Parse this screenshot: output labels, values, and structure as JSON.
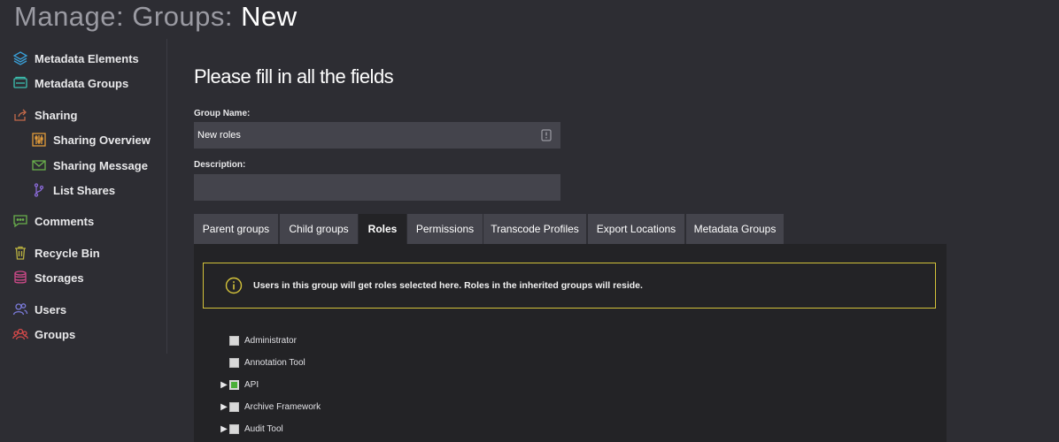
{
  "header": {
    "title_part1": "Manage: Groups: ",
    "title_part2": "New"
  },
  "sidebar": {
    "items": [
      {
        "label": "Metadata Elements",
        "icon": "layers-icon"
      },
      {
        "label": "Metadata Groups",
        "icon": "folders-icon"
      },
      {
        "label": "Sharing",
        "icon": "share-icon"
      },
      {
        "label": "Sharing Overview",
        "icon": "sliders-icon"
      },
      {
        "label": "Sharing Message",
        "icon": "envelope-icon"
      },
      {
        "label": "List Shares",
        "icon": "branch-icon"
      },
      {
        "label": "Comments",
        "icon": "comment-icon"
      },
      {
        "label": "Recycle Bin",
        "icon": "trash-icon"
      },
      {
        "label": "Storages",
        "icon": "database-icon"
      },
      {
        "label": "Users",
        "icon": "users-icon"
      },
      {
        "label": "Groups",
        "icon": "groups-icon"
      }
    ]
  },
  "form": {
    "heading": "Please fill in all the fields",
    "group_name_label": "Group Name:",
    "group_name_value": "New roles",
    "description_label": "Description:",
    "description_value": ""
  },
  "tabs": [
    {
      "label": "Parent groups"
    },
    {
      "label": "Child groups"
    },
    {
      "label": "Roles",
      "active": true
    },
    {
      "label": "Permissions"
    },
    {
      "label": "Transcode Profiles"
    },
    {
      "label": "Export Locations"
    },
    {
      "label": "Metadata Groups"
    }
  ],
  "info": {
    "text": "Users in this group will get roles selected here. Roles in the inherited groups will reside."
  },
  "roles": [
    {
      "label": "Administrator",
      "expandable": false,
      "state": "unchecked"
    },
    {
      "label": "Annotation Tool",
      "expandable": false,
      "state": "unchecked"
    },
    {
      "label": "API",
      "expandable": true,
      "state": "partial"
    },
    {
      "label": "Archive Framework",
      "expandable": true,
      "state": "unchecked"
    },
    {
      "label": "Audit Tool",
      "expandable": true,
      "state": "unchecked"
    }
  ],
  "colors": {
    "accent_yellow": "#d3c23a",
    "checkbox_green": "#4caf3a",
    "background": "#2d2d33",
    "panel": "#232326"
  }
}
